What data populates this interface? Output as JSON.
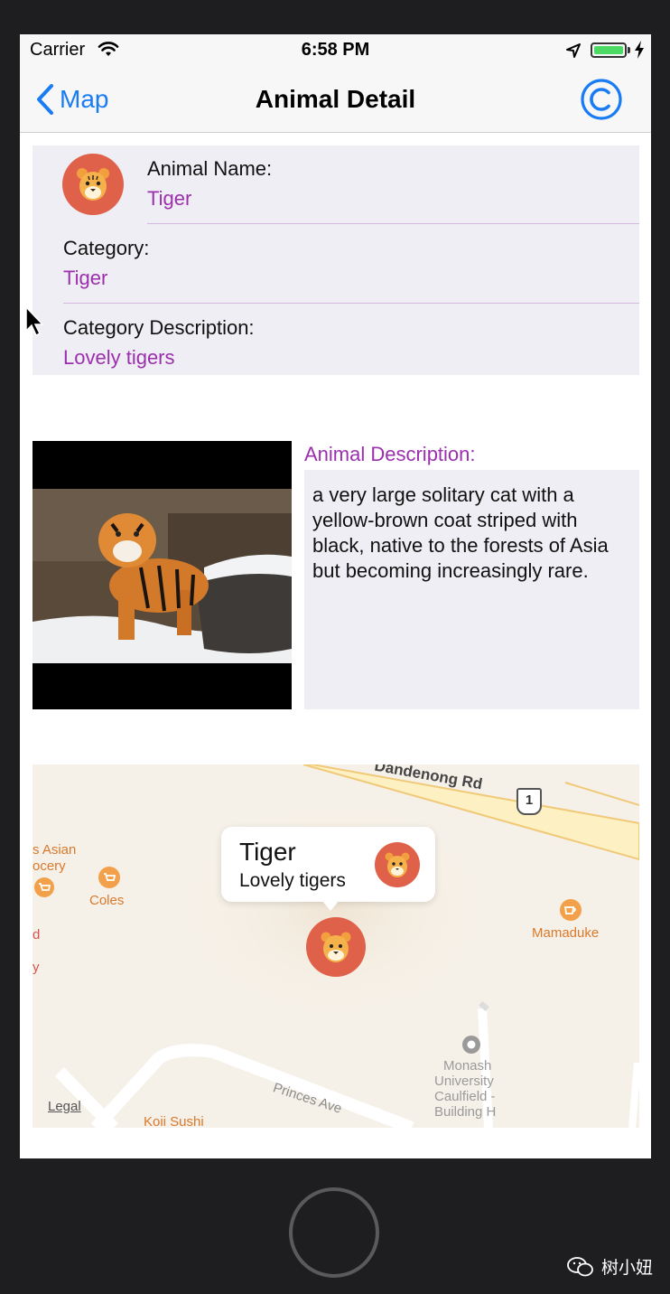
{
  "status_bar": {
    "carrier": "Carrier",
    "time": "6:58 PM"
  },
  "nav": {
    "back_label": "Map",
    "title": "Animal Detail"
  },
  "info": {
    "name_label": "Animal Name:",
    "name_value": "Tiger",
    "category_label": "Category:",
    "category_value": "Tiger",
    "category_desc_label": "Category Description:",
    "category_desc_value": "Lovely tigers"
  },
  "description": {
    "heading": "Animal Description:",
    "text": "a very large solitary cat with a yellow-brown coat striped with black, native to the forests of Asia but becoming increasingly rare."
  },
  "map": {
    "road_dandenong": "Dandenong Rd",
    "road_shield": "1",
    "poi_asian_grocery_1": "s Asian",
    "poi_asian_grocery_2": "ocery",
    "poi_coles": "Coles",
    "poi_mamaduke": "Mamaduke",
    "poi_monash": [
      "Monash",
      "University",
      "Caulfield -",
      "Building H"
    ],
    "road_princes": "Princes Ave",
    "poi_koii": "Koii Sushi",
    "legal": "Legal",
    "edge_d": "d",
    "edge_y": "y",
    "callout_title": "Tiger",
    "callout_subtitle": "Lovely tigers"
  },
  "watermark": "树小妞",
  "colors": {
    "accent": "#1a7cf5",
    "value_purple": "#9b2fae",
    "pin_red": "#e0614a",
    "poi_orange": "#d9792c"
  }
}
